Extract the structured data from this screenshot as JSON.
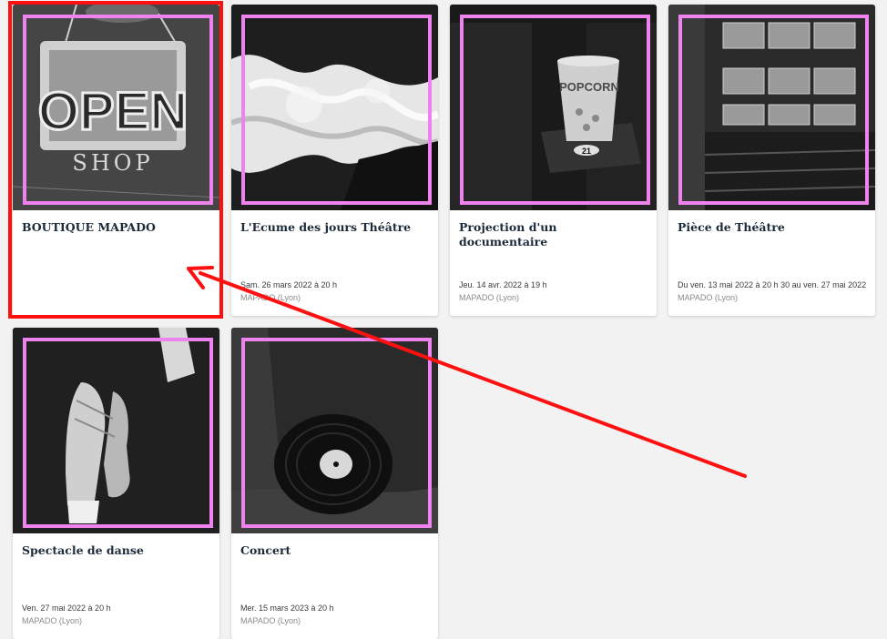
{
  "events": [
    {
      "title": "BOUTIQUE MAPADO",
      "date": "",
      "place": "",
      "image_icon": "open-shop-sign-image"
    },
    {
      "title": "L'Ecume des jours Théâtre",
      "date": "Sam. 26 mars 2022 à 20 h",
      "place": "MAPADO (Lyon)",
      "image_icon": "ocean-wave-image"
    },
    {
      "title": "Projection d'un documentaire",
      "date": "Jeu. 14 avr. 2022 à 19 h",
      "place": "MAPADO (Lyon)",
      "image_icon": "popcorn-cinema-image"
    },
    {
      "title": "Pièce de Théâtre",
      "date": "Du ven. 13 mai 2022 à 20 h 30 au ven. 27 mai 2022",
      "place": "MAPADO (Lyon)",
      "image_icon": "theatre-hall-image"
    },
    {
      "title": "Spectacle de danse",
      "date": "Ven. 27 mai 2022 à 20 h",
      "place": "MAPADO (Lyon)",
      "image_icon": "ballet-shoes-image"
    },
    {
      "title": "Concert",
      "date": "Mer. 15 mars 2023 à 20 h",
      "place": "MAPADO (Lyon)",
      "image_icon": "vinyl-record-image"
    }
  ],
  "image_text": {
    "open_sign": "OPEN",
    "shop_sign": "SHOP",
    "popcorn": "POPCORN",
    "seat_number": "21"
  },
  "colors": {
    "background": "#f2f2f2",
    "title": "#1c2b3a",
    "place": "#8a8a8a",
    "highlight": "#ff1010",
    "frame": "#ee82ee"
  }
}
